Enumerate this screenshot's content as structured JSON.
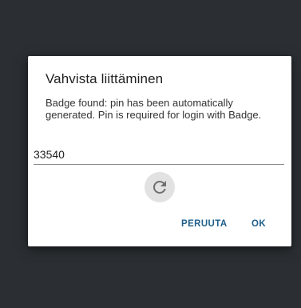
{
  "dialog": {
    "title": "Vahvista liittäminen",
    "message": "Badge found: pin has been automatically generated. Pin is required for login with Badge.",
    "pin_value": "33540",
    "refresh_icon": "refresh-icon",
    "cancel_label": "PERUUTA",
    "ok_label": "OK"
  },
  "colors": {
    "backdrop": "#2b2f33",
    "dialog_bg": "#ffffff",
    "accent": "#1f5f8b",
    "refresh_bg": "#e2e2e2",
    "refresh_icon": "#707070"
  }
}
